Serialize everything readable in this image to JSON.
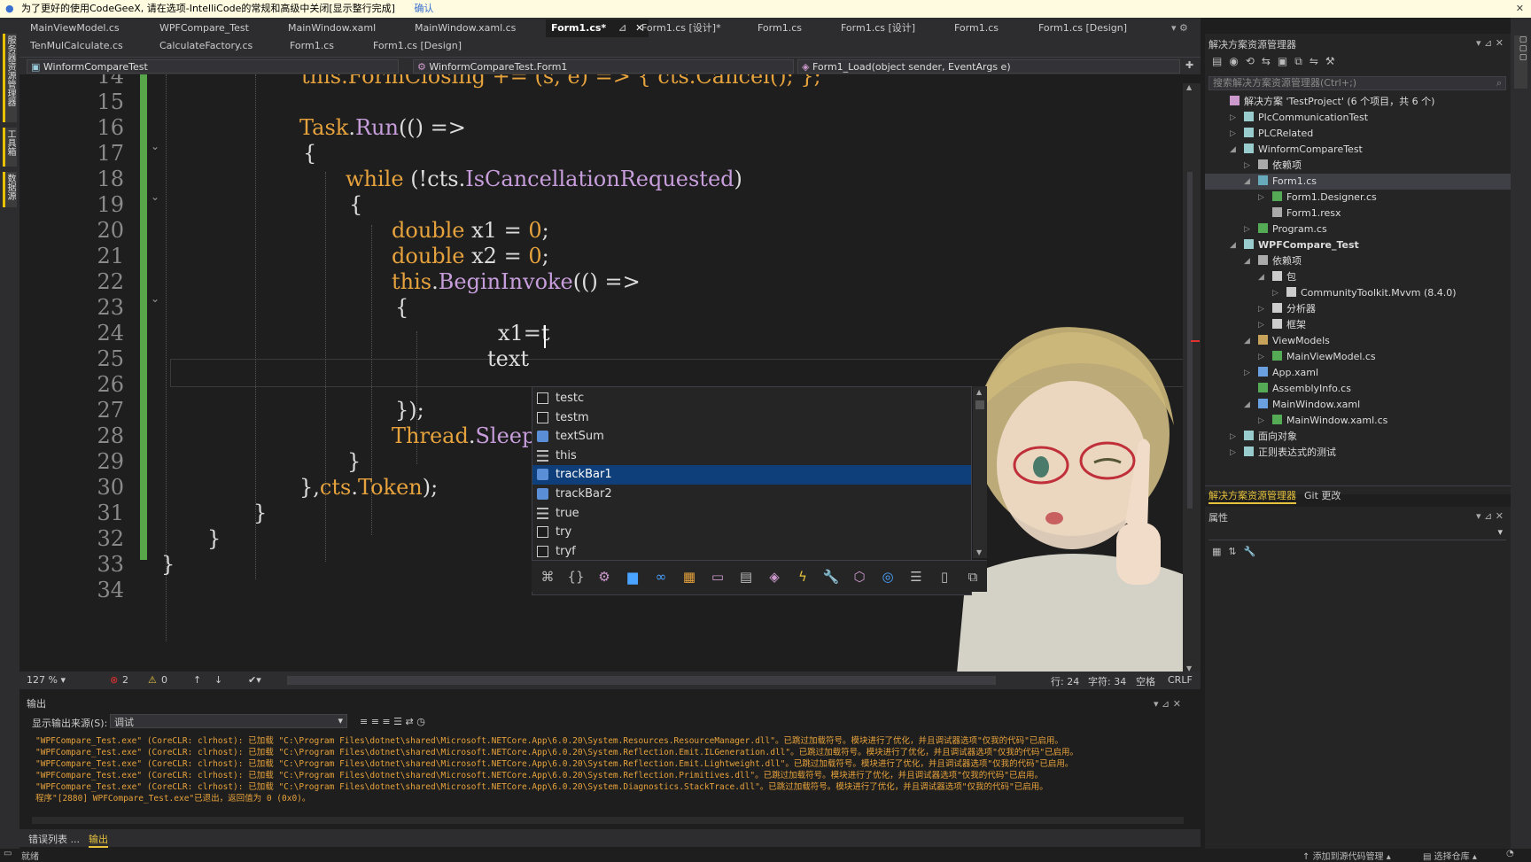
{
  "infobar": {
    "text": "为了更好的使用CodeGeeX, 请在选项-IntelliCode的常规和高级中关闭[显示整行完成]",
    "confirm": "确认"
  },
  "left_tabs": [
    "服务器资源管理器",
    "工具箱",
    "数据源"
  ],
  "tabs_row1": [
    {
      "label": "MainViewModel.cs",
      "active": false
    },
    {
      "label": "WPFCompare_Test",
      "active": false
    },
    {
      "label": "MainWindow.xaml",
      "active": false
    },
    {
      "label": "MainWindow.xaml.cs",
      "active": false
    },
    {
      "label": "Form1.cs*",
      "active": true
    },
    {
      "label": "Form1.cs [设计]*",
      "active": false
    },
    {
      "label": "Form1.cs",
      "active": false
    },
    {
      "label": "Form1.cs [设计]",
      "active": false
    },
    {
      "label": "Form1.cs",
      "active": false
    },
    {
      "label": "Form1.cs [Design]",
      "active": false
    }
  ],
  "tabs_row2": [
    {
      "label": "TenMulCalculate.cs"
    },
    {
      "label": "CalculateFactory.cs"
    },
    {
      "label": "Form1.cs"
    },
    {
      "label": "Form1.cs [Design]"
    }
  ],
  "navbar": {
    "project": "WinformCompareTest",
    "class": "WinformCompareTest.Form1",
    "member": "Form1_Load(object sender, EventArgs e)"
  },
  "editor": {
    "line_numbers": [
      "14",
      "15",
      "16",
      "17",
      "18",
      "19",
      "20",
      "21",
      "22",
      "23",
      "24",
      "25",
      "26",
      "27",
      "28",
      "29",
      "30",
      "31",
      "32",
      "33",
      "34"
    ],
    "lines": {
      "l14": "this.FormClosing += (s, e) => { cts.Cancel(); };",
      "l16a": "Task",
      "l16b": ".",
      "l16c": "Run",
      "l16d": "(() =>",
      "l17": "{",
      "l18a": "while",
      "l18b": " (!cts.",
      "l18c": "IsCancellationRequested",
      "l18d": ")",
      "l19": "{",
      "l20a": "double",
      "l20b": " x1 = ",
      "l20c": "0",
      "l20d": ";",
      "l21a": "double",
      "l21b": " x2 = ",
      "l21c": "0",
      "l21d": ";",
      "l22a": "this",
      "l22b": ".",
      "l22c": "BeginInvoke",
      "l22d": "(() =>",
      "l23": "{",
      "l24": "x1=t",
      "l25": "text",
      "l27": "});",
      "l28a": "Thread",
      "l28b": ".",
      "l28c": "Sleep",
      "l29": "}",
      "l30a": "},",
      "l30b": "cts",
      "l30c": ".",
      "l30d": "Token",
      "l30e": ");",
      "l31": "}",
      "l32": "}",
      "l33": "}"
    }
  },
  "completion": {
    "items": [
      {
        "label": "testc",
        "icon": "keyword-icon"
      },
      {
        "label": "testm",
        "icon": "keyword-icon"
      },
      {
        "label": "textSum",
        "icon": "field-icon"
      },
      {
        "label": "this",
        "icon": "lines-icon"
      },
      {
        "label": "trackBar1",
        "icon": "field-icon",
        "selected": true
      },
      {
        "label": "trackBar2",
        "icon": "field-icon"
      },
      {
        "label": "true",
        "icon": "lines-icon"
      },
      {
        "label": "try",
        "icon": "keyword-icon"
      },
      {
        "label": "tryf",
        "icon": "keyword-icon"
      }
    ],
    "filters": [
      "namespace-filter-icon",
      "braces-filter-icon",
      "class-filter-icon",
      "struct-filter-icon",
      "interface-filter-icon",
      "enum-filter-icon",
      "delegate-filter-icon",
      "module-filter-icon",
      "method-filter-icon",
      "event-filter-icon",
      "property-filter-icon",
      "field-filter-icon",
      "constant-filter-icon",
      "local-filter-icon",
      "keyword-filter-icon",
      "snippet-filter-icon"
    ]
  },
  "statusbar": {
    "zoom": "127 %",
    "errors": "2",
    "warnings": "0",
    "line": "行: 24",
    "col": "字符: 34",
    "spaces": "空格",
    "eol": "CRLF"
  },
  "output": {
    "title": "输出",
    "source_label": "显示输出来源(S):",
    "source_value": "调试",
    "lines": [
      "\"WPFCompare_Test.exe\" (CoreCLR: clrhost): 已加载 \"C:\\Program Files\\dotnet\\shared\\Microsoft.NETCore.App\\6.0.20\\System.Resources.ResourceManager.dll\"。已跳过加载符号。模块进行了优化，并且调试器选项\"仅我的代码\"已启用。",
      "\"WPFCompare_Test.exe\" (CoreCLR: clrhost): 已加载 \"C:\\Program Files\\dotnet\\shared\\Microsoft.NETCore.App\\6.0.20\\System.Reflection.Emit.ILGeneration.dll\"。已跳过加载符号。模块进行了优化，并且调试器选项\"仅我的代码\"已启用。",
      "\"WPFCompare_Test.exe\" (CoreCLR: clrhost): 已加载 \"C:\\Program Files\\dotnet\\shared\\Microsoft.NETCore.App\\6.0.20\\System.Reflection.Emit.Lightweight.dll\"。已跳过加载符号。模块进行了优化，并且调试器选项\"仅我的代码\"已启用。",
      "\"WPFCompare_Test.exe\" (CoreCLR: clrhost): 已加载 \"C:\\Program Files\\dotnet\\shared\\Microsoft.NETCore.App\\6.0.20\\System.Reflection.Primitives.dll\"。已跳过加载符号。模块进行了优化，并且调试器选项\"仅我的代码\"已启用。",
      "\"WPFCompare_Test.exe\" (CoreCLR: clrhost): 已加载 \"C:\\Program Files\\dotnet\\shared\\Microsoft.NETCore.App\\6.0.20\\System.Diagnostics.StackTrace.dll\"。已跳过加载符号。模块进行了优化，并且调试器选项\"仅我的代码\"已启用。",
      "程序\"[2880] WPFCompare_Test.exe\"已退出，返回值为 0 (0x0)。"
    ],
    "tabs": [
      "错误列表 ...",
      "输出"
    ]
  },
  "solution": {
    "title": "解决方案资源管理器",
    "search_placeholder": "搜索解决方案资源管理器(Ctrl+;)",
    "items": [
      {
        "label": "解决方案 'TestProject' (6 个项目，共 6 个)",
        "depth": 0,
        "icon": "solution-icon",
        "arrow": ""
      },
      {
        "label": "PlcCommunicationTest",
        "depth": 1,
        "icon": "project-icon",
        "arrow": "▷"
      },
      {
        "label": "PLCRelated",
        "depth": 1,
        "icon": "project-icon",
        "arrow": "▷"
      },
      {
        "label": "WinformCompareTest",
        "depth": 1,
        "icon": "project-icon",
        "arrow": "◢"
      },
      {
        "label": "依赖项",
        "depth": 2,
        "icon": "dependencies-icon",
        "arrow": "▷"
      },
      {
        "label": "Form1.cs",
        "depth": 2,
        "icon": "form-icon",
        "arrow": "◢",
        "selected": true
      },
      {
        "label": "Form1.Designer.cs",
        "depth": 3,
        "icon": "csharp-file-icon",
        "arrow": "▷"
      },
      {
        "label": "Form1.resx",
        "depth": 3,
        "icon": "resx-icon",
        "arrow": ""
      },
      {
        "label": "Program.cs",
        "depth": 2,
        "icon": "csharp-file-icon",
        "arrow": "▷"
      },
      {
        "label": "WPFCompare_Test",
        "depth": 1,
        "icon": "project-icon",
        "arrow": "◢",
        "bold": true
      },
      {
        "label": "依赖项",
        "depth": 2,
        "icon": "dependencies-icon",
        "arrow": "◢"
      },
      {
        "label": "包",
        "depth": 3,
        "icon": "package-icon",
        "arrow": "◢"
      },
      {
        "label": "CommunityToolkit.Mvvm (8.4.0)",
        "depth": 4,
        "icon": "package-icon",
        "arrow": "▷"
      },
      {
        "label": "分析器",
        "depth": 3,
        "icon": "analyzer-icon",
        "arrow": "▷"
      },
      {
        "label": "框架",
        "depth": 3,
        "icon": "framework-icon",
        "arrow": "▷"
      },
      {
        "label": "ViewModels",
        "depth": 2,
        "icon": "folder-icon",
        "arrow": "◢"
      },
      {
        "label": "MainViewModel.cs",
        "depth": 3,
        "icon": "csharp-file-icon",
        "arrow": "▷"
      },
      {
        "label": "App.xaml",
        "depth": 2,
        "icon": "xaml-icon",
        "arrow": "▷"
      },
      {
        "label": "AssemblyInfo.cs",
        "depth": 2,
        "icon": "csharp-file-icon",
        "arrow": ""
      },
      {
        "label": "MainWindow.xaml",
        "depth": 2,
        "icon": "xaml-icon",
        "arrow": "◢"
      },
      {
        "label": "MainWindow.xaml.cs",
        "depth": 3,
        "icon": "csharp-file-icon",
        "arrow": "▷"
      },
      {
        "label": "面向对象",
        "depth": 1,
        "icon": "project-icon",
        "arrow": "▷"
      },
      {
        "label": "正则表达式的测试",
        "depth": 1,
        "icon": "project-icon",
        "arrow": "▷"
      }
    ],
    "tabs": [
      "解决方案资源管理器",
      "Git 更改"
    ]
  },
  "properties": {
    "title": "属性"
  },
  "bottombar": {
    "ready": "就绪",
    "right1": "添加到源代码管理",
    "right2": "选择仓库"
  },
  "colors": {
    "accent": "#007acc",
    "selection": "#0e3f7a",
    "keyword": "#e6a23c",
    "method": "#c79ddc",
    "green_change": "#57a64a"
  }
}
